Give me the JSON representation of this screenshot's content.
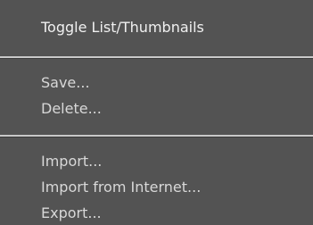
{
  "menu": {
    "items": [
      {
        "label": "Toggle List/Thumbnails"
      },
      {
        "label": "Save..."
      },
      {
        "label": "Delete..."
      },
      {
        "label": "Import..."
      },
      {
        "label": "Import from Internet..."
      },
      {
        "label": "Export..."
      }
    ]
  },
  "colors": {
    "background": "#535353",
    "text": "#e6e6e6",
    "separator": "#c9c9c9"
  }
}
